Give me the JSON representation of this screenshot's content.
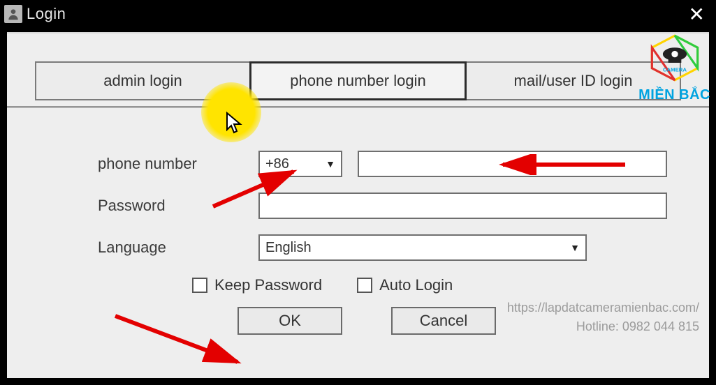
{
  "window": {
    "title": "Login"
  },
  "tabs": {
    "admin": "admin login",
    "phone": "phone number login",
    "mail": "mail/user ID login",
    "active": "phone"
  },
  "form": {
    "phone_label": "phone number",
    "country_code": "+86",
    "phone_value": "",
    "password_label": "Password",
    "password_value": "",
    "language_label": "Language",
    "language_value": "English",
    "keep_password_label": "Keep Password",
    "keep_password_checked": false,
    "auto_login_label": "Auto Login",
    "auto_login_checked": false,
    "ok_label": "OK",
    "cancel_label": "Cancel"
  },
  "watermark": {
    "url": "https://lapdatcameramienbac.com/",
    "hotline": "Hotline: 0982 044 815"
  },
  "brand": {
    "name": "MIỀN BẮC",
    "logo_label": "CAMERA"
  }
}
